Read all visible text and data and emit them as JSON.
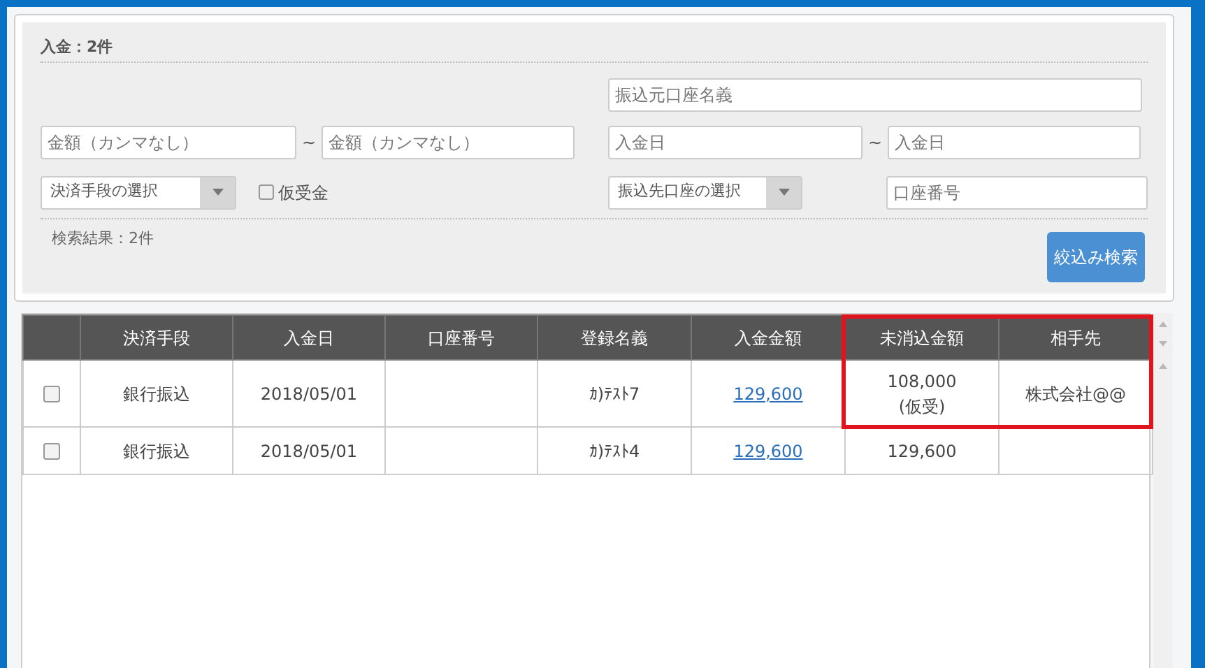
{
  "search_panel": {
    "title": "入金：2件",
    "fields": [
      {
        "placeholder": "振込元口座名義"
      },
      {
        "placeholder": "金額（カンマなし）"
      },
      {
        "placeholder": "金額（カンマなし）"
      },
      {
        "placeholder": "入金日"
      },
      {
        "placeholder": "入金日"
      },
      {
        "placeholder": "口座番号"
      }
    ],
    "range_separators": [
      "~",
      "~"
    ],
    "selects": [
      {
        "value": "決済手段の選択"
      },
      {
        "value": "振込先口座の選択"
      }
    ],
    "checkbox": {
      "label": "仮受金",
      "checked": false
    },
    "result_count": "検索結果：2件",
    "search_button": "絞込み検索"
  },
  "table": {
    "columns": [
      {
        "label": "決済手段",
        "highlighted": false
      },
      {
        "label": "入金日",
        "highlighted": false
      },
      {
        "label": "口座番号",
        "highlighted": false
      },
      {
        "label": "登録名義",
        "highlighted": false
      },
      {
        "label": "入金金額",
        "highlighted": false
      },
      {
        "label": "未消込金額",
        "highlighted": true
      },
      {
        "label": "相手先",
        "highlighted": true
      }
    ],
    "rows": [
      {
        "checked": false,
        "cells": [
          {
            "text": "銀行振込",
            "kind": "text"
          },
          {
            "text": "2018/05/01",
            "kind": "text"
          },
          null,
          {
            "text": "ｶ)ﾃｽﾄ7",
            "kind": "text"
          },
          {
            "text": "129,600",
            "kind": "link"
          },
          {
            "text": "108,000\n(仮受)",
            "kind": "text"
          },
          {
            "text": "株式会社@@",
            "kind": "text"
          }
        ]
      },
      {
        "checked": false,
        "cells": [
          {
            "text": "銀行振込",
            "kind": "text"
          },
          {
            "text": "2018/05/01",
            "kind": "text"
          },
          null,
          {
            "text": "ｶ)ﾃｽﾄ4",
            "kind": "text"
          },
          {
            "text": "129,600",
            "kind": "link"
          },
          {
            "text": "129,600",
            "kind": "text"
          },
          null
        ]
      }
    ]
  }
}
